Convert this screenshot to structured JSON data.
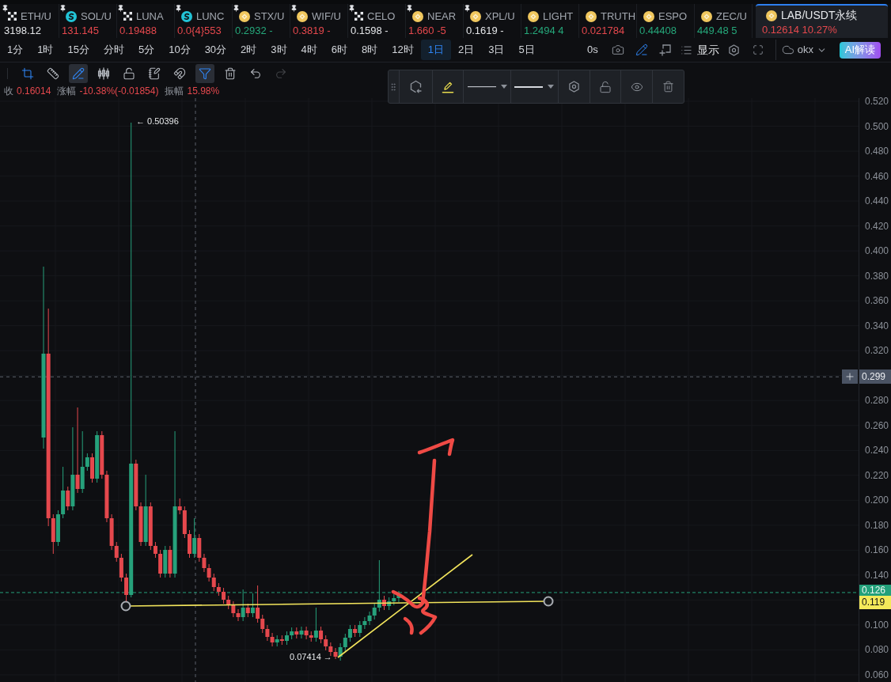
{
  "tickers": [
    {
      "symbol": "ETH/U",
      "price": "3198.12",
      "color": "#e3e5e8",
      "kind": "checker",
      "pinned": true,
      "selected": false
    },
    {
      "symbol": "SOL/U",
      "price": "131.145",
      "color": "#e5484d",
      "kind": "swirl",
      "pinned": true,
      "selected": false
    },
    {
      "symbol": "LUNA",
      "price": "0.19488",
      "color": "#e5484d",
      "kind": "checker",
      "pinned": true,
      "selected": false
    },
    {
      "symbol": "LUNC",
      "price": "0.0{4}553",
      "color": "#e5484d",
      "kind": "swirl",
      "pinned": true,
      "selected": false
    },
    {
      "symbol": "STX/U",
      "price": "0.2932 -",
      "color": "#25a77a",
      "kind": "coin",
      "pinned": true,
      "selected": false
    },
    {
      "symbol": "WIF/U",
      "price": "0.3819 -",
      "color": "#e5484d",
      "kind": "coin",
      "pinned": true,
      "selected": false
    },
    {
      "symbol": "CELO",
      "price": "0.1598 -",
      "color": "#e3e5e8",
      "kind": "checker",
      "pinned": true,
      "selected": false
    },
    {
      "symbol": "NEAR",
      "price": "1.660 -5",
      "color": "#e5484d",
      "kind": "coin",
      "pinned": true,
      "selected": false
    },
    {
      "symbol": "XPL/U",
      "price": "0.1619 -",
      "color": "#e3e5e8",
      "kind": "coin",
      "pinned": true,
      "selected": false
    },
    {
      "symbol": "LIGHT",
      "price": "1.2494 4",
      "color": "#25a77a",
      "kind": "coin",
      "pinned": false,
      "selected": false
    },
    {
      "symbol": "TRUTH",
      "price": "0.021784",
      "color": "#e5484d",
      "kind": "coin",
      "pinned": false,
      "selected": false
    },
    {
      "symbol": "ESPO",
      "price": "0.44408",
      "color": "#25a77a",
      "kind": "coin",
      "pinned": false,
      "selected": false
    },
    {
      "symbol": "ZEC/U",
      "price": "449.48 5",
      "color": "#25a77a",
      "kind": "coin",
      "pinned": false,
      "selected": false
    },
    {
      "symbol": "LAB/USDT永续",
      "price": "0.12614 10.27%",
      "color": "#e5484d",
      "kind": "coin",
      "pinned": false,
      "selected": true
    }
  ],
  "intervals": [
    {
      "label": "1分",
      "selected": false
    },
    {
      "label": "1时",
      "selected": false
    },
    {
      "label": "15分",
      "selected": false
    },
    {
      "label": "分时",
      "selected": false
    },
    {
      "label": "5分",
      "selected": false
    },
    {
      "label": "10分",
      "selected": false
    },
    {
      "label": "30分",
      "selected": false
    },
    {
      "label": "2时",
      "selected": false
    },
    {
      "label": "3时",
      "selected": false
    },
    {
      "label": "4时",
      "selected": false
    },
    {
      "label": "6时",
      "selected": false
    },
    {
      "label": "8时",
      "selected": false
    },
    {
      "label": "12时",
      "selected": false
    },
    {
      "label": "1日",
      "selected": true
    },
    {
      "label": "2日",
      "selected": false
    },
    {
      "label": "3日",
      "selected": false
    },
    {
      "label": "5日",
      "selected": false
    }
  ],
  "header": {
    "countdown": "0s",
    "tools": [
      {
        "active": false
      },
      {
        "active": true
      },
      {
        "active": false
      }
    ],
    "display_label": "显示",
    "exchange": "okx",
    "ai_button": "AI解读"
  },
  "drawing_tools": [
    {
      "active": true,
      "selected": false,
      "disabled": false
    },
    {
      "active": false,
      "selected": false,
      "disabled": false
    },
    {
      "active": true,
      "selected": true,
      "disabled": false
    },
    {
      "active": false,
      "selected": false,
      "disabled": false
    },
    {
      "active": false,
      "selected": false,
      "disabled": false
    },
    {
      "active": false,
      "selected": false,
      "disabled": false
    },
    {
      "active": false,
      "selected": false,
      "disabled": false
    },
    {
      "active": true,
      "selected": true,
      "disabled": false
    },
    {
      "active": false,
      "selected": false,
      "disabled": false
    },
    {
      "active": false,
      "selected": false,
      "disabled": false
    },
    {
      "active": false,
      "selected": false,
      "disabled": true
    }
  ],
  "stats": [
    {
      "label": "收",
      "value": "0.16014"
    },
    {
      "label": "涨幅",
      "value": "-10.38%(-0.01854)"
    },
    {
      "label": "振幅",
      "value": "15.98%"
    }
  ],
  "drawing_editor": {
    "locked": false,
    "visible": true
  },
  "chart": {
    "price_axis": [
      "0.520",
      "0.500",
      "0.480",
      "0.460",
      "0.440",
      "0.420",
      "0.400",
      "0.380",
      "0.360",
      "0.340",
      "0.320",
      "0.280",
      "0.260",
      "0.240",
      "0.220",
      "0.200",
      "0.180",
      "0.160",
      "0.140",
      "0.100",
      "0.080",
      "0.060"
    ],
    "crosshair_price": "0.299",
    "last_price": "0.126",
    "line_price": "0.119",
    "high_marker": "← 0.50396",
    "low_marker": "0.07414 →"
  }
}
